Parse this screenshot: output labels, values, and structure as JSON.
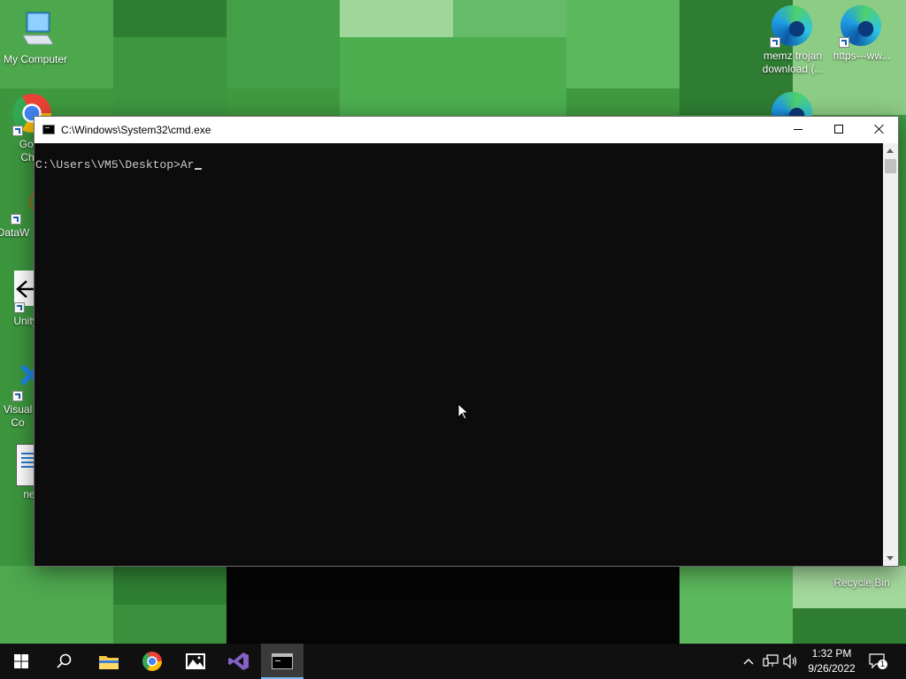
{
  "desktop": {
    "icons": [
      {
        "label": "My Computer",
        "icon": "computer-icon"
      },
      {
        "label": "Goo Chr",
        "icon": "chrome-icon"
      },
      {
        "label": "DataW",
        "icon": "datawrapper-icon"
      },
      {
        "label": "Unity",
        "icon": "unity-icon"
      },
      {
        "label": "Visual Co",
        "icon": "vscode-icon"
      },
      {
        "label": "ne",
        "icon": "notepad-icon"
      },
      {
        "label": "memz trojan download (...",
        "icon": "edge-icon"
      },
      {
        "label": "https---ww...",
        "icon": "edge-icon"
      },
      {
        "label": "Recycle Bin",
        "icon": "recycle-bin-icon"
      }
    ]
  },
  "window": {
    "title": "C:\\Windows\\System32\\cmd.exe",
    "prompt": "C:\\Users\\VM5\\Desktop>",
    "typed": "Ar",
    "colors": {
      "console_bg": "#0c0c0c",
      "console_text": "#cccccc",
      "titlebar": "#ffffff"
    }
  },
  "taskbar": {
    "apps": [
      {
        "name": "start",
        "icon": "windows-icon"
      },
      {
        "name": "search",
        "icon": "search-icon"
      },
      {
        "name": "file-explorer",
        "icon": "folder-icon"
      },
      {
        "name": "chrome",
        "icon": "chrome-icon"
      },
      {
        "name": "photos",
        "icon": "photos-icon"
      },
      {
        "name": "visual-studio",
        "icon": "visual-studio-icon"
      },
      {
        "name": "command-prompt",
        "icon": "cmd-icon",
        "active": true
      }
    ],
    "clock": {
      "time": "1:32 PM",
      "date": "9/26/2022"
    },
    "notifications": "1",
    "accent": "#76b9ed"
  }
}
